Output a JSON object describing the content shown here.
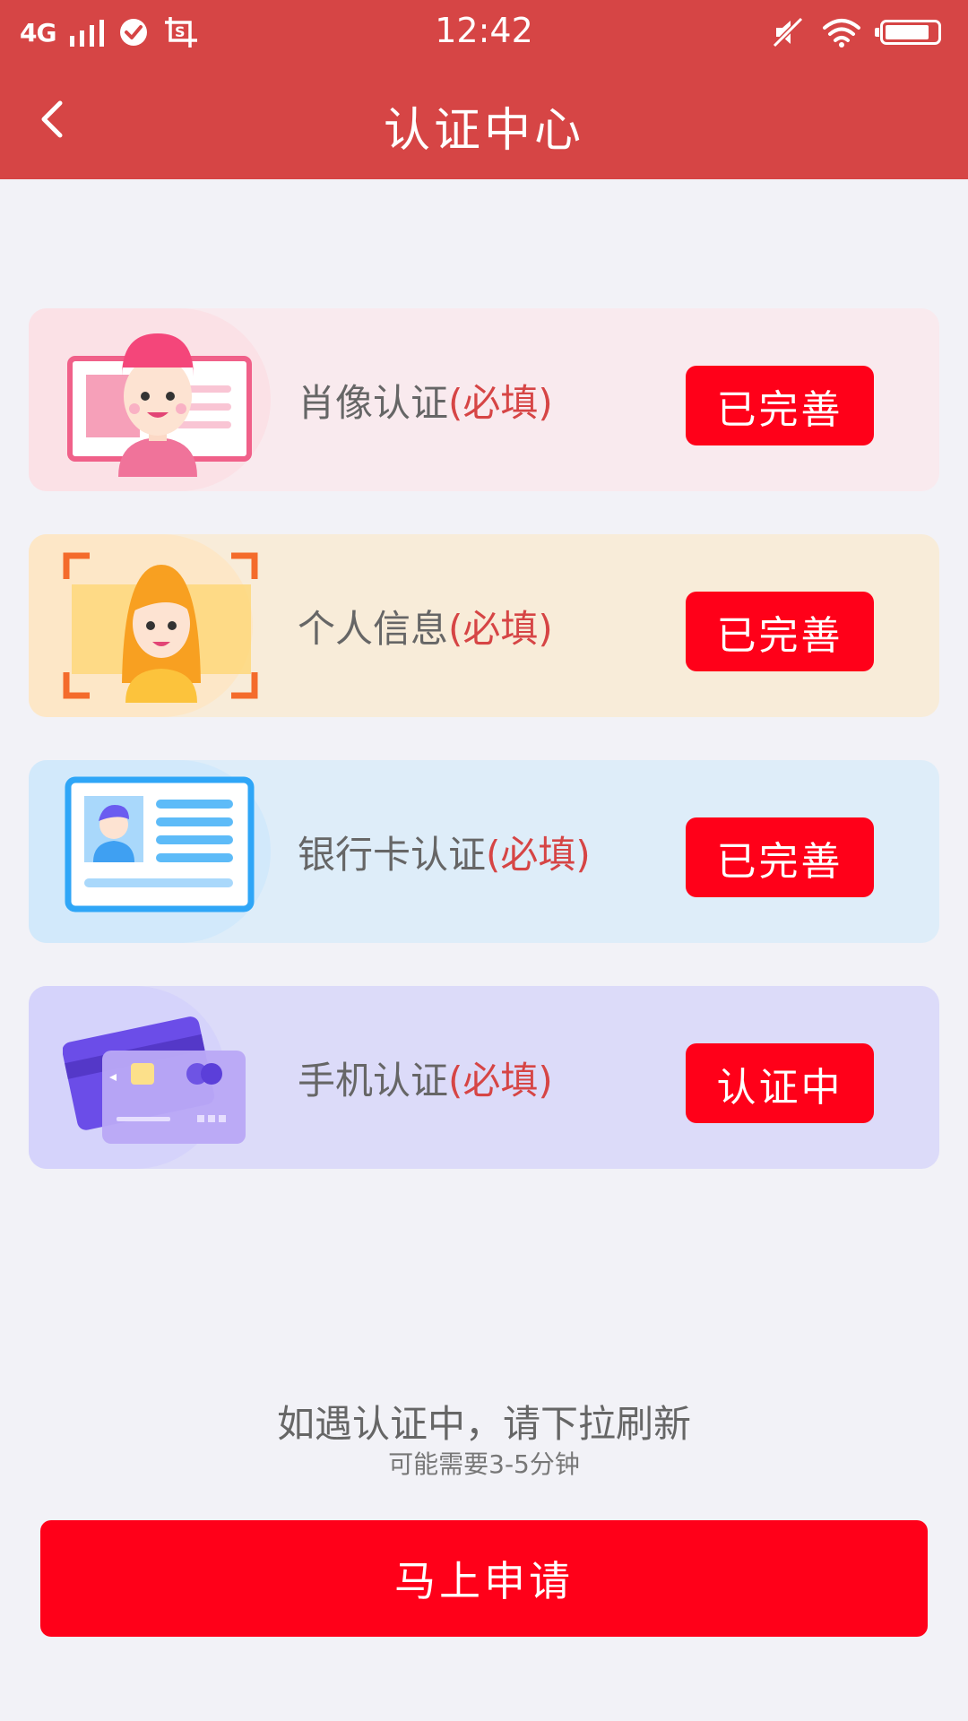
{
  "status_bar": {
    "network": "4G",
    "time": "12:42",
    "icons": [
      "signal-icon",
      "check-circle-icon",
      "screenshot-icon",
      "mute-icon",
      "wifi-icon",
      "battery-icon"
    ]
  },
  "header": {
    "title": "认证中心",
    "back_icon": "chevron-left-icon"
  },
  "cards": [
    {
      "label": "肖像认证",
      "required": "(必填)",
      "button": "已完善",
      "icon": "portrait-icon"
    },
    {
      "label": "个人信息",
      "required": "(必填)",
      "button": "已完善",
      "icon": "face-scan-icon"
    },
    {
      "label": "银行卡认证",
      "required": "(必填)",
      "button": "已完善",
      "icon": "id-card-icon"
    },
    {
      "label": "手机认证",
      "required": "(必填)",
      "button": "认证中",
      "icon": "credit-card-icon"
    }
  ],
  "footer": {
    "tip": "如遇认证中，请下拉刷新",
    "subtip": "可能需要3-5分钟",
    "apply_button": "马上申请"
  },
  "colors": {
    "header_bg": "#d64545",
    "button_red": "#ff0019",
    "page_bg": "#f2f2f7"
  }
}
